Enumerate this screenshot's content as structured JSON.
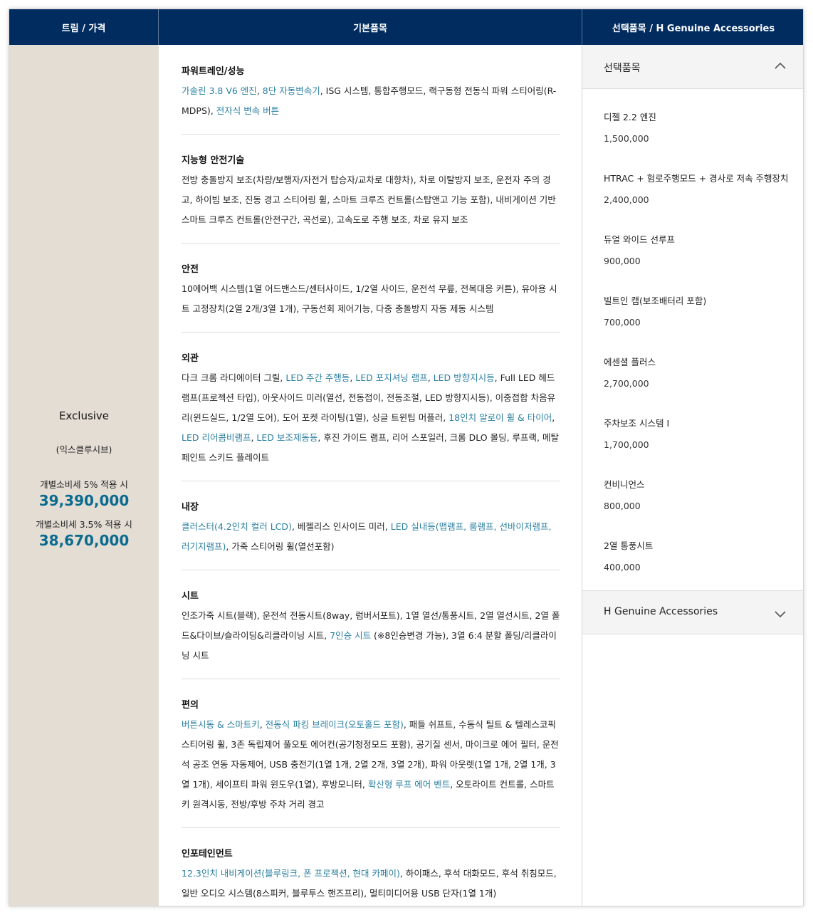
{
  "header": {
    "col_trim": "트림 / 가격",
    "col_basic": "기본품목",
    "col_options": "선택품목 / H Genuine Accessories"
  },
  "trim": {
    "name": "Exclusive",
    "name_kor": "(익스클루시브)",
    "tax1_label": "개별소비세 5% 적용 시",
    "price1": "39,390,000",
    "tax2_label": "개별소비세 3.5% 적용 시",
    "price2": "38,670,000"
  },
  "sections": [
    {
      "title": "파워트레인/성능",
      "segments": [
        {
          "t": "가솔린 3.8 V6 엔진",
          "hl": true
        },
        {
          "t": ", "
        },
        {
          "t": "8단 자동변속기",
          "hl": true
        },
        {
          "t": ", ISG 시스템, 통합주행모드, 랙구동형 전동식 파워 스티어링(R-MDPS), "
        },
        {
          "t": "전자식 변속 버튼",
          "hl": true
        }
      ]
    },
    {
      "title": "지능형 안전기술",
      "segments": [
        {
          "t": "전방 충돌방지 보조(차량/보행자/자전거 탑승자/교차로 대향차), 차로 이탈방지 보조, 운전자 주의 경고, 하이빔 보조, 진동 경고 스티어링 휠, 스마트 크루즈 컨트롤(스탑앤고 기능 포함), 내비게이션 기반 스마트 크루즈 컨트롤(안전구간, 곡선로), 고속도로 주행 보조, 차로 유지 보조"
        }
      ]
    },
    {
      "title": "안전",
      "segments": [
        {
          "t": "10에어백 시스템(1열 어드밴스드/센터사이드, 1/2열 사이드, 운전석 무릎, 전복대응 커튼), 유아용 시트 고정장치(2열 2개/3열 1개), 구동선회 제어기능, 다중 충돌방지 자동 제동 시스템"
        }
      ]
    },
    {
      "title": "외관",
      "segments": [
        {
          "t": "다크 크롬 라디에이터 그릴, "
        },
        {
          "t": "LED 주간 주행등",
          "hl": true
        },
        {
          "t": ", "
        },
        {
          "t": "LED 포지셔닝 램프",
          "hl": true
        },
        {
          "t": ", "
        },
        {
          "t": "LED 방향지시등",
          "hl": true
        },
        {
          "t": ", Full LED 헤드램프(프로젝션 타입), 아웃사이드 미러(열선, 전동접이, 전동조절, LED 방향지시등), 이중접합 차음유리(윈드실드, 1/2열 도어), 도어 포켓 라이팅(1열), 싱글 트윈팁 머플러, "
        },
        {
          "t": "18인치 알로이 휠 & 타이어",
          "hl": true
        },
        {
          "t": ", "
        },
        {
          "t": "LED 리어콤비램프",
          "hl": true
        },
        {
          "t": ", "
        },
        {
          "t": "LED 보조제동등",
          "hl": true
        },
        {
          "t": ", 후진 가이드 램프, 리어 스포일러, 크롬 DLO 몰딩, 루프랙, 메탈페인트 스키드 플레이트"
        }
      ]
    },
    {
      "title": "내장",
      "segments": [
        {
          "t": "클러스터(4.2인치 컬러 LCD)",
          "hl": true
        },
        {
          "t": ", 베젤리스 인사이드 미러, "
        },
        {
          "t": "LED 실내등(맵램프, 룸램프, 선바이저램프, 러기지램프)",
          "hl": true
        },
        {
          "t": ", 가죽 스티어링 휠(열선포함)"
        }
      ]
    },
    {
      "title": "시트",
      "segments": [
        {
          "t": "인조가죽 시트(블랙), 운전석 전동시트(8way, 럼버서포트), 1열 열선/통풍시트, 2열 열선시트, 2열 폴드&다이브/슬라이딩&리클라이닝 시트, "
        },
        {
          "t": "7인승 시트",
          "hl": true
        },
        {
          "t": " (※8인승변경 가능), 3열 6:4 분할 폴딩/리클라이닝 시트"
        }
      ]
    },
    {
      "title": "편의",
      "segments": [
        {
          "t": "버튼시동 & 스마트키",
          "hl": true
        },
        {
          "t": ", "
        },
        {
          "t": "전동식 파킹 브레이크(오토홀드 포함)",
          "hl": true
        },
        {
          "t": ", 패들 쉬프트, 수동식 틸트 & 텔레스코픽 스티어링 휠, 3존 독립제어 풀오토 에어컨(공기청정모드 포함), 공기질 센서, 마이크로 에어 필터, 운전석 공조 연동 자동제어, USB 충전기(1열 1개, 2열 2개, 3열 2개), 파워 아웃렛(1열 1개, 2열 1개, 3열 1개), 세이프티 파워 윈도우(1열), 후방모니터, "
        },
        {
          "t": "확산형 루프 에어 벤트",
          "hl": true
        },
        {
          "t": ", 오토라이트 컨트롤, 스마트키 원격시동, 전방/후방 주차 거리 경고"
        }
      ]
    },
    {
      "title": "인포테인먼트",
      "segments": [
        {
          "t": "12.3인치 내비게이션(블루링크, 폰 프로젝션, 현대 카페이)",
          "hl": true
        },
        {
          "t": ", 하이패스, 후석 대화모드, 후석 취침모드, 일반 오디오 시스템(8스피커, 블루투스 핸즈프리), 멀티미디어용 USB 단자(1열 1개)"
        }
      ]
    }
  ],
  "options_panel": {
    "title": "선택품목",
    "items": [
      {
        "name": "디젤 2.2 엔진",
        "price": "1,500,000"
      },
      {
        "name": "HTRAC + 험로주행모드 + 경사로 저속 주행장치",
        "price": "2,400,000"
      },
      {
        "name": "듀얼 와이드 선루프",
        "price": "900,000"
      },
      {
        "name": "빌트인 캠(보조배터리 포함)",
        "price": "700,000"
      },
      {
        "name": "에센셜 플러스",
        "price": "2,700,000"
      },
      {
        "name": "주차보조 시스템 I",
        "price": "1,700,000"
      },
      {
        "name": "컨비니언스",
        "price": "800,000"
      },
      {
        "name": "2열 통풍시트",
        "price": "400,000"
      }
    ]
  },
  "accessories_panel": {
    "title": "H Genuine Accessories"
  },
  "colors": {
    "header_bg": "#002c5f",
    "trim_bg": "#e4ddd4",
    "price": "#0a6b8f",
    "highlight": "#2a7fa0"
  }
}
